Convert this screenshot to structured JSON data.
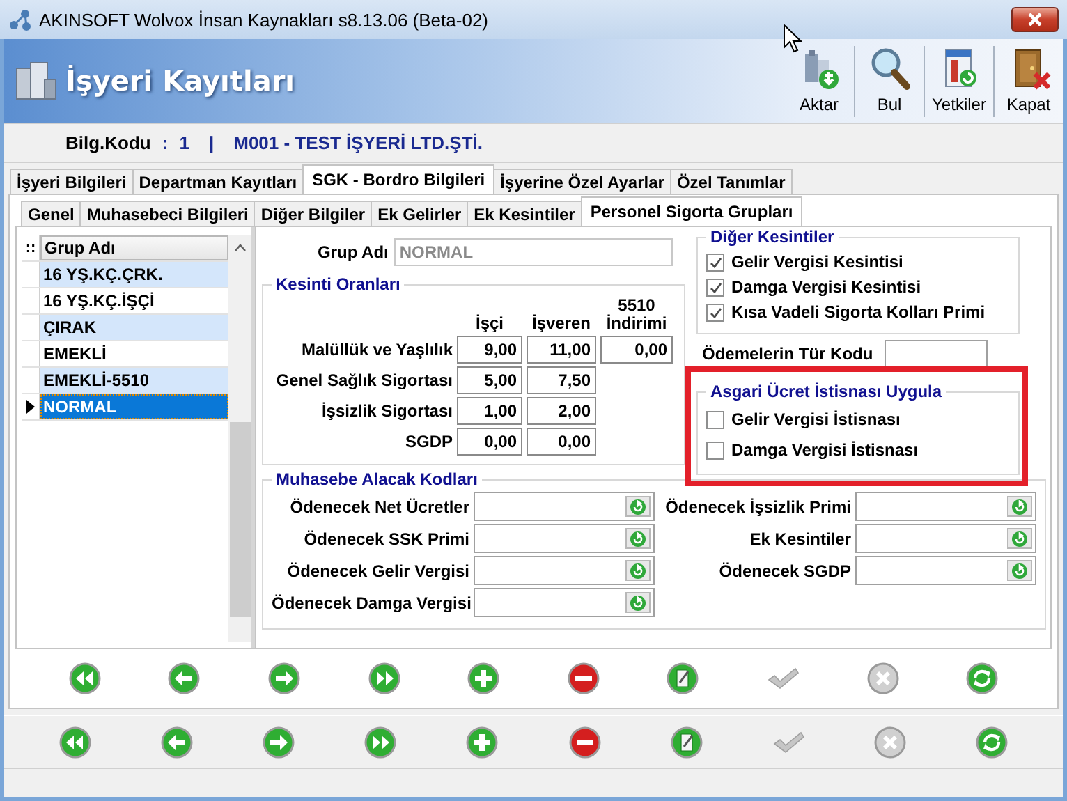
{
  "window": {
    "title": "AKINSOFT Wolvox İnsan Kaynakları s8.13.06 (Beta-02)"
  },
  "header": {
    "title": "İşyeri Kayıtları",
    "toolbar": [
      {
        "label": "Aktar",
        "kind": "export"
      },
      {
        "label": "Bul",
        "kind": "find"
      },
      {
        "label": "Yetkiler",
        "kind": "permissions"
      },
      {
        "label": "Kapat",
        "kind": "exit"
      }
    ]
  },
  "info_bar": {
    "label": "Bilg.Kodu",
    "separator": ":",
    "code": "1",
    "divider": "|",
    "company": "M001 - TEST İŞYERİ LTD.ŞTİ."
  },
  "tabs": [
    {
      "label": "İşyeri Bilgileri",
      "selected": false
    },
    {
      "label": "Departman Kayıtları",
      "selected": false
    },
    {
      "label": "SGK - Bordro  Bilgileri",
      "selected": true
    },
    {
      "label": "İşyerine Özel Ayarlar",
      "selected": false
    },
    {
      "label": "Özel Tanımlar",
      "selected": false
    }
  ],
  "sub_tabs": [
    {
      "label": "Genel",
      "selected": false
    },
    {
      "label": "Muhasebeci Bilgileri",
      "selected": false
    },
    {
      "label": "Diğer Bilgiler",
      "selected": false
    },
    {
      "label": "Ek Gelirler",
      "selected": false
    },
    {
      "label": "Ek Kesintiler",
      "selected": false
    },
    {
      "label": "Personel Sigorta Grupları",
      "selected": true
    }
  ],
  "group_list": {
    "marker": "::",
    "column": "Grup Adı",
    "rows": [
      {
        "name": "16 YŞ.KÇ.ÇRK.",
        "selected": false
      },
      {
        "name": "16 YŞ.KÇ.İŞÇİ",
        "selected": false
      },
      {
        "name": "ÇIRAK",
        "selected": false
      },
      {
        "name": "EMEKLİ",
        "selected": false
      },
      {
        "name": "EMEKLİ-5510",
        "selected": false
      },
      {
        "name": "NORMAL",
        "selected": true
      }
    ]
  },
  "form": {
    "group_name": {
      "label": "Grup Adı",
      "value": "NORMAL",
      "disabled": true
    },
    "rates": {
      "title": "Kesinti Oranları",
      "columns": [
        "İşçi",
        "İşveren",
        "5510 İndirimi"
      ],
      "rows": [
        {
          "label": "Malüllük ve Yaşlılık",
          "values": [
            "9,00",
            "11,00",
            "0,00"
          ]
        },
        {
          "label": "Genel Sağlık Sigortası",
          "values": [
            "5,00",
            "7,50"
          ]
        },
        {
          "label": "İşsizlik Sigortası",
          "values": [
            "1,00",
            "2,00"
          ]
        },
        {
          "label": "SGDP",
          "values": [
            "0,00",
            "0,00"
          ]
        }
      ]
    },
    "other_deductions": {
      "title": "Diğer Kesintiler",
      "items": [
        {
          "label": "Gelir Vergisi Kesintisi",
          "checked": true
        },
        {
          "label": "Damga Vergisi Kesintisi",
          "checked": true
        },
        {
          "label": "Kısa Vadeli Sigorta Kolları Primi",
          "checked": true
        }
      ]
    },
    "payment_type_code": {
      "label": "Ödemelerin Tür Kodu"
    },
    "minimum_wage_exemption": {
      "title": "Asgari Ücret İstisnası Uygula",
      "highlighted": true,
      "items": [
        {
          "label": "Gelir Vergisi İstisnası",
          "checked": false
        },
        {
          "label": "Damga Vergisi İstisnası",
          "checked": false
        }
      ]
    },
    "accounting_codes": {
      "title": "Muhasebe Alacak Kodları",
      "left": [
        "Ödenecek Net Ücretler",
        "Ödenecek SSK Primi",
        "Ödenecek Gelir Vergisi",
        "Ödenecek Damga Vergisi"
      ],
      "right": [
        "Ödenecek İşsizlik Primi",
        "Ek Kesintiler",
        "Ödenecek SGDP"
      ]
    }
  },
  "nav_bars": [
    {
      "buttons": [
        {
          "kind": "first",
          "disabled": false
        },
        {
          "kind": "prev",
          "disabled": false
        },
        {
          "kind": "next",
          "disabled": false
        },
        {
          "kind": "last",
          "disabled": false
        },
        {
          "kind": "add",
          "disabled": false
        },
        {
          "kind": "delete",
          "disabled": false
        },
        {
          "kind": "edit",
          "disabled": false
        },
        {
          "kind": "confirm",
          "disabled": true
        },
        {
          "kind": "cancel",
          "disabled": true
        },
        {
          "kind": "refresh",
          "disabled": false
        }
      ]
    },
    {
      "buttons": [
        {
          "kind": "first",
          "disabled": false
        },
        {
          "kind": "prev",
          "disabled": false
        },
        {
          "kind": "next",
          "disabled": false
        },
        {
          "kind": "last",
          "disabled": false
        },
        {
          "kind": "add",
          "disabled": false
        },
        {
          "kind": "delete",
          "disabled": false
        },
        {
          "kind": "edit",
          "disabled": false
        },
        {
          "kind": "confirm",
          "disabled": true
        },
        {
          "kind": "cancel",
          "disabled": true
        },
        {
          "kind": "refresh",
          "disabled": false
        }
      ]
    }
  ]
}
